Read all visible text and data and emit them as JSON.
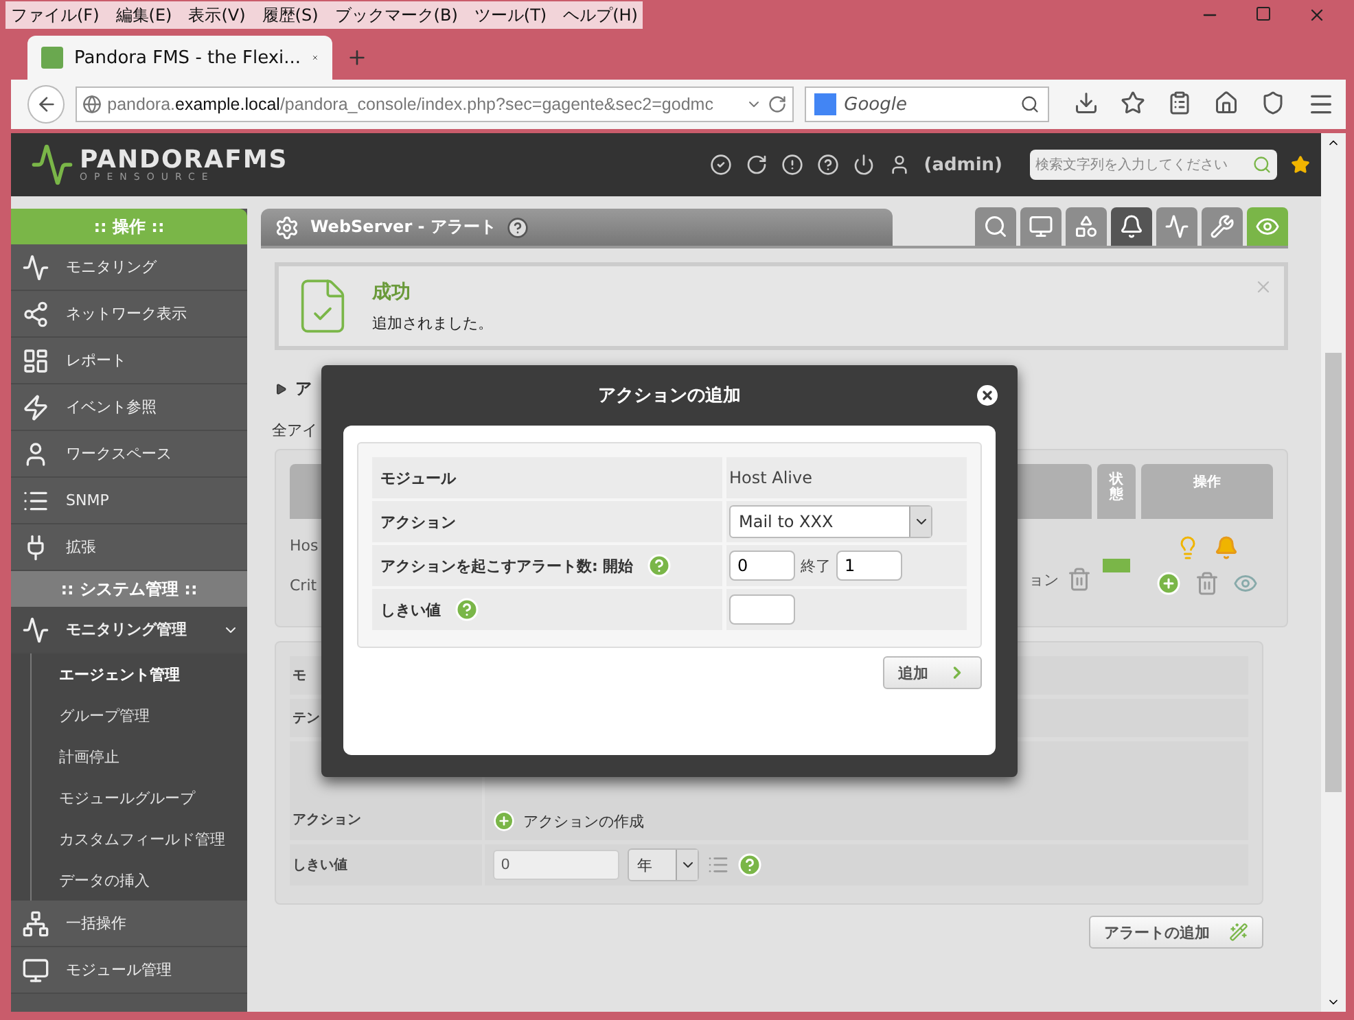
{
  "browser": {
    "menu": [
      "ファイル(F)",
      "編集(E)",
      "表示(V)",
      "履歴(S)",
      "ブックマーク(B)",
      "ツール(T)",
      "ヘルプ(H)"
    ],
    "tab": {
      "title": "Pandora FMS - the Flexi..."
    },
    "address": {
      "prefix": "pandora.",
      "host": "example.local",
      "path": "/pandora_console/index.php?sec=gagente&sec2=godmc"
    },
    "search": {
      "placeholder": "Google"
    }
  },
  "header": {
    "logo": "PANDORAFMS",
    "logo_sub": "OPENSOURCE",
    "user": "(admin)",
    "search": {
      "placeholder": "検索文字列を入力してください"
    }
  },
  "sidebar": {
    "sections": [
      {
        "title": ":: 操作 ::",
        "kind": "primary",
        "items": [
          {
            "label": "モニタリング"
          },
          {
            "label": "ネットワーク表示"
          },
          {
            "label": "レポート"
          },
          {
            "label": "イベント参照"
          },
          {
            "label": "ワークスペース"
          },
          {
            "label": "SNMP"
          },
          {
            "label": "拡張"
          }
        ]
      },
      {
        "title": ":: システム管理 ::",
        "kind": "secondary",
        "items": [
          {
            "label": "モニタリング管理",
            "expanded": true,
            "children": [
              {
                "label": "エージェント管理",
                "selected": true
              },
              {
                "label": "グループ管理",
                "selected": false
              },
              {
                "label": "計画停止",
                "selected": false
              },
              {
                "label": "モジュールグループ",
                "selected": false
              },
              {
                "label": "カスタムフィールド管理",
                "selected": false
              },
              {
                "label": "データの挿入",
                "selected": false
              }
            ]
          },
          {
            "label": "一括操作"
          },
          {
            "label": "モジュール管理"
          }
        ]
      }
    ]
  },
  "page_title": "WebServer - アラート",
  "toolbar_tabs": [
    {
      "kind": "tab",
      "selected": false
    },
    {
      "kind": "tab",
      "selected": false
    },
    {
      "kind": "tab",
      "selected": false
    },
    {
      "kind": "tab",
      "selected": true
    },
    {
      "kind": "tab",
      "selected": false
    },
    {
      "kind": "tab",
      "selected": false
    },
    {
      "kind": "view",
      "selected": false
    }
  ],
  "notice": {
    "title": "成功",
    "message": "追加されました。"
  },
  "collapsed_section": {
    "label": "ア"
  },
  "list_caption": "全アイ",
  "alerts_table": {
    "columns": [
      {
        "label": "状態"
      },
      {
        "label": "操作"
      }
    ],
    "rows": [
      {
        "lines": [
          "Hos",
          "Crit"
        ],
        "action": "ョン",
        "ok": true
      }
    ]
  },
  "form": {
    "rows": [
      {
        "kind": "text",
        "label": "モ"
      },
      {
        "kind": "text",
        "label": "テン"
      },
      {
        "kind": "link",
        "label": "アクション",
        "link": "アクションの作成"
      },
      {
        "kind": "threshold",
        "label": "しきい値",
        "value": "0",
        "unit": "年"
      }
    ]
  },
  "add_alert_button": "アラートの追加",
  "modal": {
    "title": "アクションの追加",
    "rows": [
      {
        "kind": "text",
        "label": "モジュール",
        "help": false,
        "value": "Host Alive"
      },
      {
        "kind": "select",
        "label": "アクション",
        "help": false,
        "value": "Mail to XXX"
      },
      {
        "kind": "range",
        "label": "アクションを起こすアラート数: 開始",
        "help": true,
        "from": "0",
        "to_label": "終了",
        "to": "1"
      },
      {
        "kind": "input",
        "label": "しきい値",
        "help": true
      }
    ],
    "submit": "追加"
  }
}
